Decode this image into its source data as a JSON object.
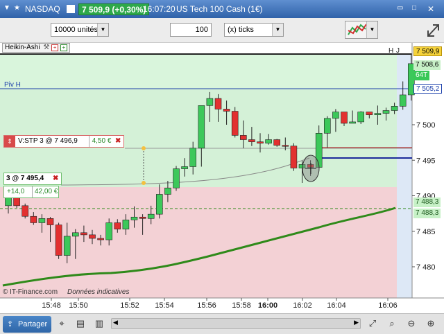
{
  "titlebar": {
    "instrument": "NASDAQ",
    "last_price": "7 509,9 (+0,30%)",
    "time": "16:07:20",
    "description": "US Tech 100 Cash (1€)",
    "up_color": "#2ea84a"
  },
  "toolbar": {
    "size_value": "10000 unités",
    "tick_value": "100",
    "tick_unit": "(x) ticks"
  },
  "chart": {
    "study_label": "Heikin-Ashi",
    "piv_label": "Piv H",
    "footer_left": "© IT-Finance.com",
    "footer_right": "Données indicatives",
    "last_price_tag": "7 509,9",
    "bid_ask_tag": "7 508,6",
    "ticks_tag": "64T",
    "piv_price_tag": "7 505,2",
    "ma_tag_1": "7 488,3",
    "ma_tag_2": "7 488,3",
    "corner_label": "H",
    "corner_label_2": "J",
    "y_ticks": [
      "7 500",
      "7 495",
      "7 490",
      "7 485",
      "7 480"
    ],
    "x_ticks": [
      "15:48",
      "15:50",
      "15:52",
      "15:54",
      "15:56",
      "15:58",
      "16:00",
      "16:02",
      "16:04",
      "16:06"
    ],
    "bull_color": "#3cc85a",
    "bear_color": "#e23030",
    "ma_color": "#2f8a1a",
    "piv_color": "#1b3faa"
  },
  "stop_order": {
    "label": "V:STP  3 @ 7 496,9",
    "amount": "4,50 €"
  },
  "position": {
    "label": "3 @ 7 495,4",
    "points": "+14,0",
    "amount": "42,00 €"
  },
  "chart_data": {
    "type": "candlestick",
    "title": "NASDAQ",
    "ylim": [
      7476,
      7512
    ],
    "ohlc": [
      [
        7488.6,
        7490.0,
        7487.5,
        7489.8
      ],
      [
        7489.8,
        7490.0,
        7488.3,
        7488.6
      ],
      [
        7488.6,
        7488.9,
        7486.8,
        7487.1
      ],
      [
        7487.1,
        7487.7,
        7485.9,
        7486.2
      ],
      [
        7486.2,
        7487.4,
        7484.8,
        7486.8
      ],
      [
        7486.8,
        7487.0,
        7483.5,
        7485.9
      ],
      [
        7485.9,
        7486.2,
        7481.1,
        7481.6
      ],
      [
        7481.6,
        7486.2,
        7480.5,
        7484.3
      ],
      [
        7484.3,
        7485.3,
        7481.1,
        7484.8
      ],
      [
        7484.8,
        7485.8,
        7483.5,
        7484.5
      ],
      [
        7484.5,
        7485.2,
        7483.2,
        7484.0
      ],
      [
        7484.0,
        7484.5,
        7483.0,
        7483.8
      ],
      [
        7483.8,
        7486.8,
        7483.0,
        7486.2
      ],
      [
        7486.2,
        7486.7,
        7484.8,
        7485.3
      ],
      [
        7485.3,
        7487.4,
        7484.5,
        7486.6
      ],
      [
        7486.6,
        7488.5,
        7485.5,
        7487.0
      ],
      [
        7487.0,
        7487.4,
        7484.5,
        7486.8
      ],
      [
        7486.8,
        7488.6,
        7486.0,
        7487.4
      ],
      [
        7487.4,
        7491.6,
        7486.8,
        7490.2
      ],
      [
        7490.2,
        7492.1,
        7489.1,
        7491.1
      ],
      [
        7491.1,
        7494.2,
        7490.7,
        7493.8
      ],
      [
        7493.8,
        7495.3,
        7492.7,
        7494.1
      ],
      [
        7494.1,
        7497.6,
        7493.0,
        7496.7
      ],
      [
        7496.7,
        7500.7,
        7494.1,
        7502.7
      ],
      [
        7502.7,
        7504.6,
        7500.4,
        7503.7
      ],
      [
        7503.7,
        7504.3,
        7500.4,
        7502.2
      ],
      [
        7502.2,
        7503.4,
        7500.0,
        7501.9
      ],
      [
        7501.9,
        7502.5,
        7498.2,
        7498.5
      ],
      [
        7498.5,
        7500.6,
        7496.7,
        7497.9
      ],
      [
        7497.9,
        7499.7,
        7497.0,
        7497.6
      ],
      [
        7497.6,
        7498.8,
        7496.1,
        7497.4
      ],
      [
        7497.4,
        7498.7,
        7497.2,
        7497.9
      ],
      [
        7497.9,
        7498.0,
        7496.9,
        7497.1
      ],
      [
        7497.1,
        7498.2,
        7496.4,
        7497.0
      ],
      [
        7497.0,
        7497.4,
        7493.5,
        7493.9
      ],
      [
        7493.9,
        7494.9,
        7491.8,
        7494.4
      ],
      [
        7494.4,
        7495.0,
        7492.8,
        7494.0
      ],
      [
        7494.0,
        7499.9,
        7494.4,
        7498.8
      ],
      [
        7498.8,
        7501.2,
        7496.8,
        7500.9
      ],
      [
        7500.9,
        7502.2,
        7499.0,
        7501.8
      ],
      [
        7501.8,
        7501.3,
        7499.8,
        7500.2
      ],
      [
        7500.2,
        7502.0,
        7500.2,
        7500.4
      ],
      [
        7500.4,
        7501.9,
        7500.1,
        7501.8
      ],
      [
        7501.8,
        7501.5,
        7500.9,
        7501.4
      ],
      [
        7501.4,
        7502.7,
        7500.0,
        7501.6
      ],
      [
        7501.6,
        7502.4,
        7500.6,
        7502.0
      ],
      [
        7502.0,
        7503.1,
        7501.5,
        7502.6
      ],
      [
        7502.6,
        7506.1,
        7502.1,
        7504.2
      ],
      [
        7504.2,
        7509.9,
        7503.4,
        7508.6
      ]
    ]
  }
}
